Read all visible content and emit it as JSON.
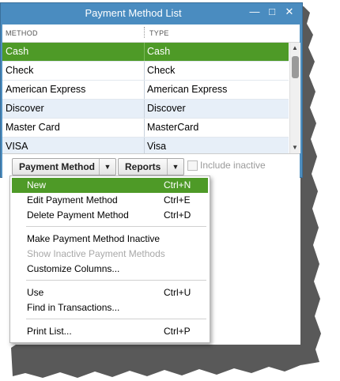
{
  "window": {
    "title": "Payment Method List",
    "minimize_icon": "minimize-icon",
    "maximize_icon": "maximize-icon",
    "close_icon": "close-icon"
  },
  "table": {
    "columns": [
      "METHOD",
      "TYPE"
    ],
    "rows": [
      {
        "method": "Cash",
        "type": "Cash"
      },
      {
        "method": "Check",
        "type": "Check"
      },
      {
        "method": "American Express",
        "type": "American Express"
      },
      {
        "method": "Discover",
        "type": "Discover"
      },
      {
        "method": "Master Card",
        "type": "MasterCard"
      },
      {
        "method": "VISA",
        "type": "Visa"
      }
    ],
    "selected_row": 0
  },
  "footer": {
    "payment_method_label": "Payment Method",
    "reports_label": "Reports",
    "include_inactive_label": "Include inactive"
  },
  "menu": {
    "items": [
      {
        "label": "New",
        "shortcut": "Ctrl+N"
      },
      {
        "label": "Edit Payment Method",
        "shortcut": "Ctrl+E"
      },
      {
        "label": "Delete Payment Method",
        "shortcut": "Ctrl+D"
      },
      {
        "label": "Make Payment Method Inactive",
        "shortcut": ""
      },
      {
        "label": "Show Inactive Payment Methods",
        "shortcut": ""
      },
      {
        "label": "Customize Columns...",
        "shortcut": ""
      },
      {
        "label": "Use",
        "shortcut": "Ctrl+U"
      },
      {
        "label": "Find in Transactions...",
        "shortcut": ""
      },
      {
        "label": "Print List...",
        "shortcut": "Ctrl+P"
      }
    ]
  },
  "colors": {
    "selection": "#4e9a27",
    "titlebar": "#4a8cc0"
  }
}
